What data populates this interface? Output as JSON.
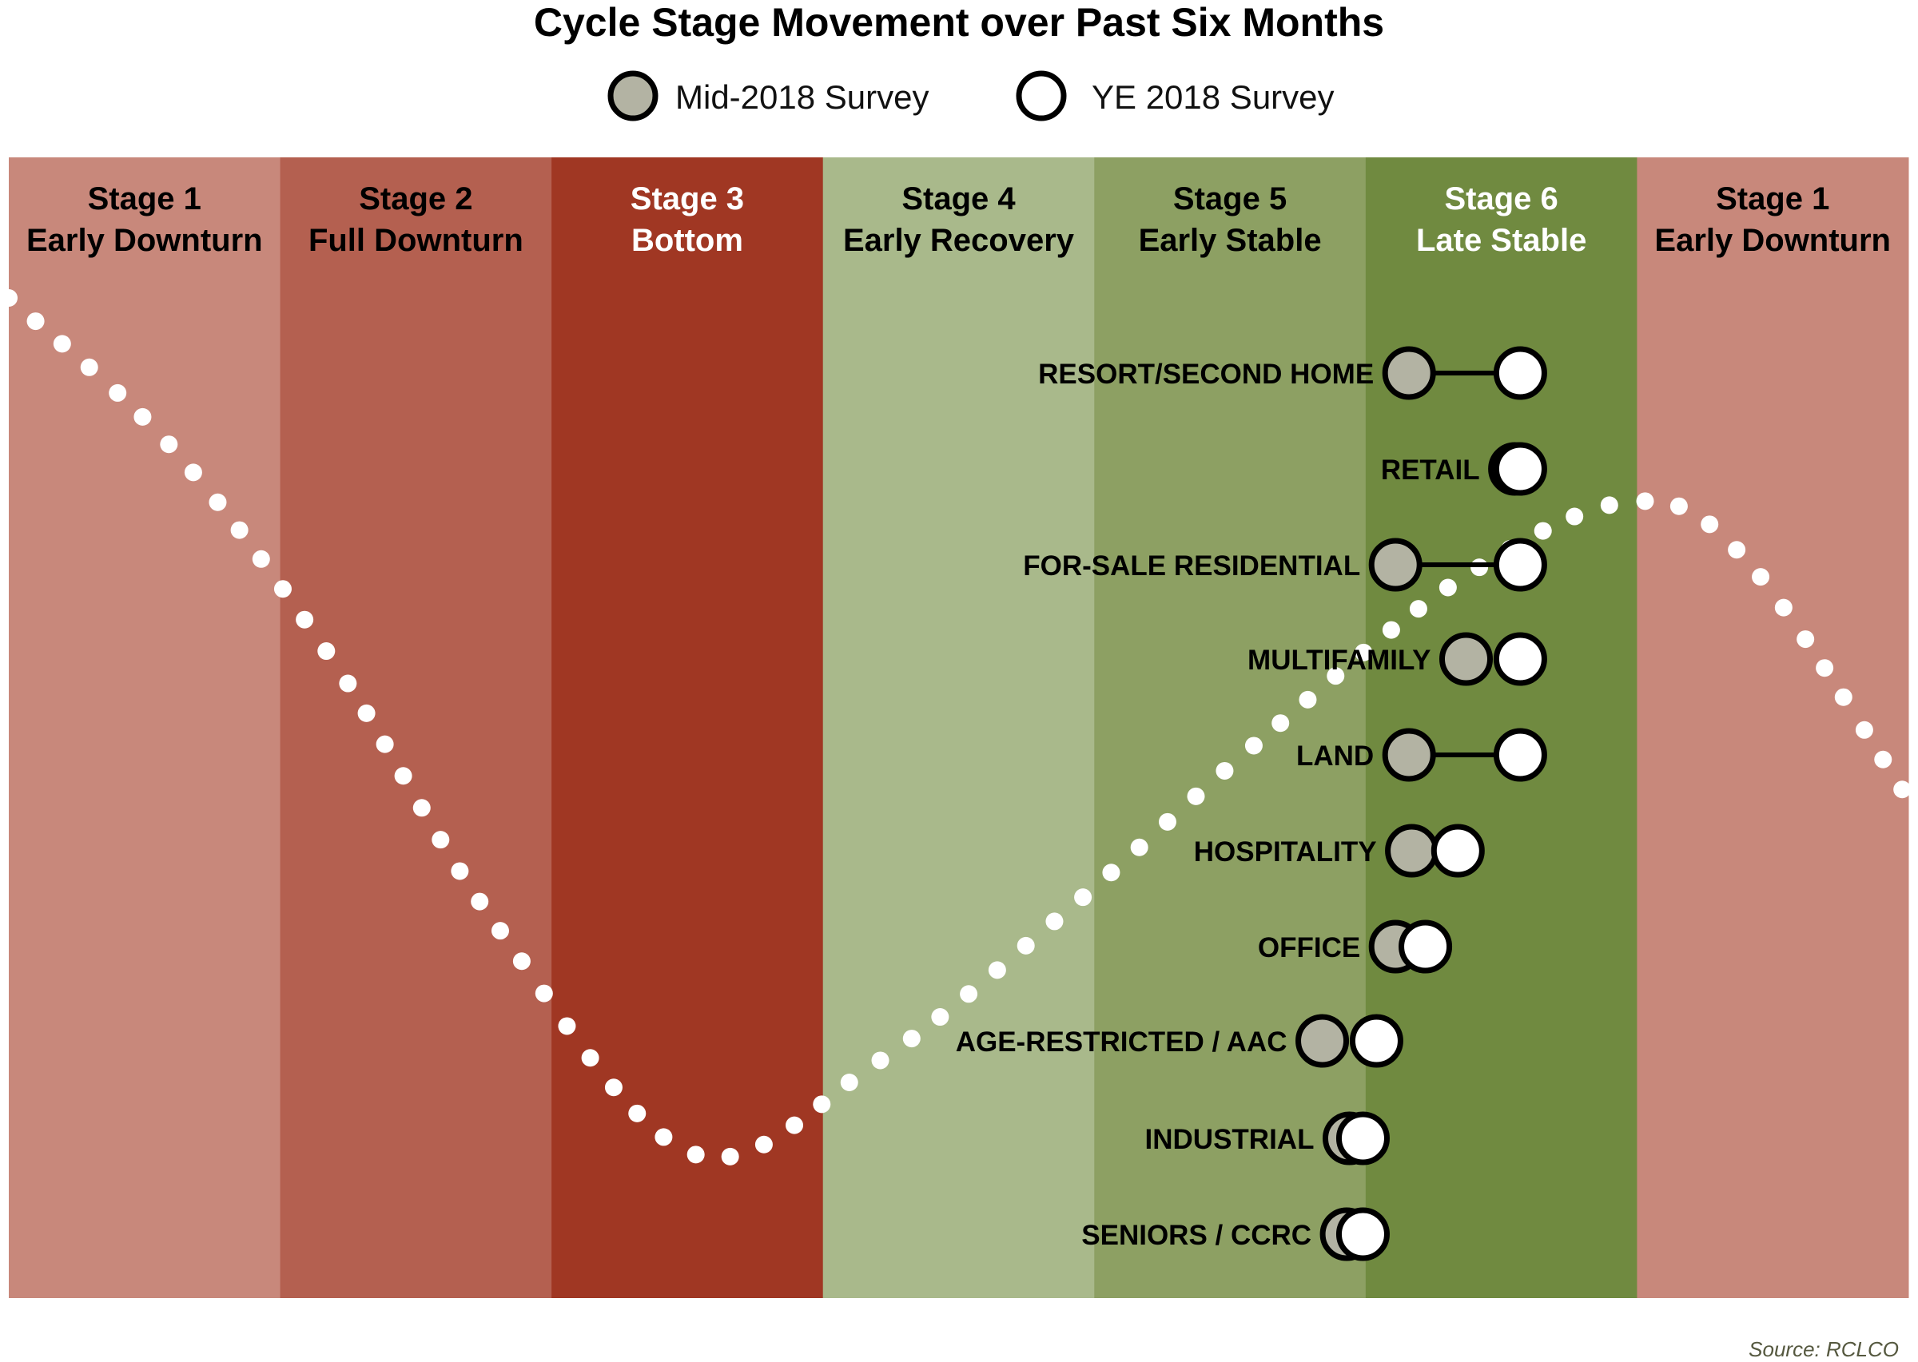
{
  "chart_data": {
    "type": "scatter",
    "title": "Cycle Stage Movement over Past Six Months",
    "source": "Source: RCLCO",
    "legend": {
      "placement": "top-center",
      "entries": [
        {
          "name": "Mid-2018 Survey",
          "fill": "#b3b3a3",
          "stroke": "#000000"
        },
        {
          "name": "YE 2018 Survey",
          "fill": "#ffffff",
          "stroke": "#000000"
        }
      ]
    },
    "stages": [
      {
        "line1": "Stage 1",
        "line2": "Early Downturn",
        "color": "#c8887b",
        "text_color": "#000000"
      },
      {
        "line1": "Stage 2",
        "line2": "Full Downturn",
        "color": "#b46050",
        "text_color": "#000000"
      },
      {
        "line1": "Stage 3",
        "line2": "Bottom",
        "color": "#a03723",
        "text_color": "#ffffff"
      },
      {
        "line1": "Stage 4",
        "line2": "Early Recovery",
        "color": "#a9b98b",
        "text_color": "#000000"
      },
      {
        "line1": "Stage 5",
        "line2": "Early Stable",
        "color": "#8da063",
        "text_color": "#000000"
      },
      {
        "line1": "Stage 6",
        "line2": "Late Stable",
        "color": "#708a40",
        "text_color": "#ffffff"
      },
      {
        "line1": "Stage 1",
        "line2": "Early Downturn",
        "color": "#c8887b",
        "text_color": "#000000"
      }
    ],
    "x_unit": "cycle position (stage n spans n-1 to n)",
    "xlim": [
      0,
      7
    ],
    "categories": [
      "RESORT/SECOND HOME",
      "RETAIL",
      "FOR-SALE RESIDENTIAL",
      "MULTIFAMILY",
      "LAND",
      "HOSPITALITY",
      "OFFICE",
      "AGE-RESTRICTED / AAC",
      "INDUSTRIAL",
      "SENIORS / CCRC"
    ],
    "series": [
      {
        "name": "Mid-2018 Survey",
        "values": [
          5.16,
          5.55,
          5.11,
          5.37,
          5.16,
          5.17,
          5.11,
          4.84,
          4.94,
          4.93
        ]
      },
      {
        "name": "YE 2018 Survey",
        "values": [
          5.57,
          5.57,
          5.57,
          5.57,
          5.57,
          5.34,
          5.22,
          5.04,
          4.99,
          4.99
        ]
      }
    ],
    "connectors": [
      true,
      false,
      true,
      false,
      true,
      false,
      false,
      false,
      false,
      false
    ]
  }
}
